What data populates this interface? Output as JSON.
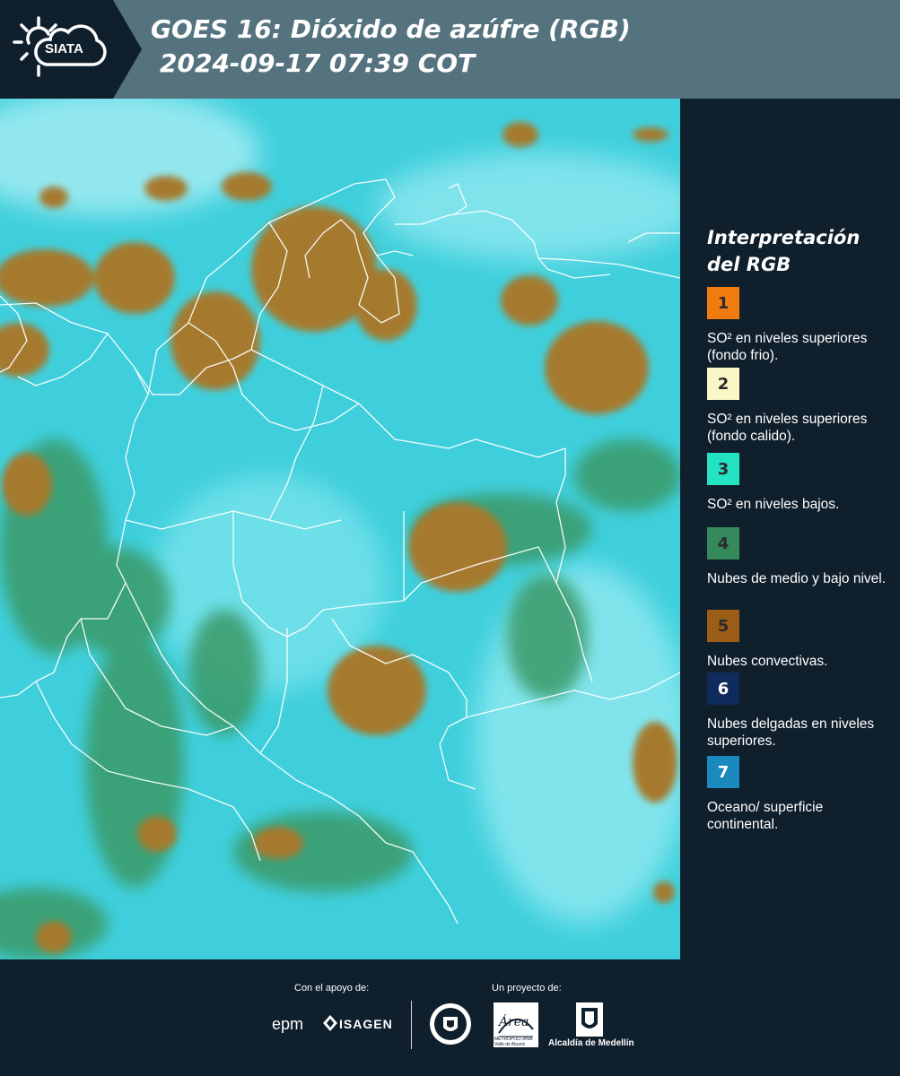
{
  "header": {
    "logo": "SIATA",
    "title_line1": "GOES 16: Dióxido de azúfre (RGB)",
    "title_line2": "2024-09-17 07:39 COT"
  },
  "legend": {
    "title": "Interpretación del RGB",
    "items": [
      {
        "num": "1",
        "color": "#f07c0f",
        "label": "SO² en niveles superiores (fondo frio)."
      },
      {
        "num": "2",
        "color": "#fbf6c6",
        "label": "SO² en niveles superiores (fondo calido)."
      },
      {
        "num": "3",
        "color": "#24e3c3",
        "label": "SO² en niveles bajos."
      },
      {
        "num": "4",
        "color": "#36895c",
        "label": "Nubes de medio y bajo nivel."
      },
      {
        "num": "5",
        "color": "#9c5e16",
        "label": "Nubes convectivas."
      },
      {
        "num": "6",
        "color": "#0f2a5c",
        "label": "Nubes delgadas en niveles superiores."
      },
      {
        "num": "7",
        "color": "#1989be",
        "label": "Oceano/ superficie continental."
      }
    ]
  },
  "footer": {
    "support_label": "Con el apoyo de:",
    "project_label": "Un proyecto de:",
    "brand_epm": "epm",
    "brand_isagen": "ISAGEN",
    "brand_area": "Área",
    "brand_area_sub": "METROPOLITANA\nValle de Aburrá",
    "brand_alcaldia": "Alcaldía de Medellín"
  }
}
